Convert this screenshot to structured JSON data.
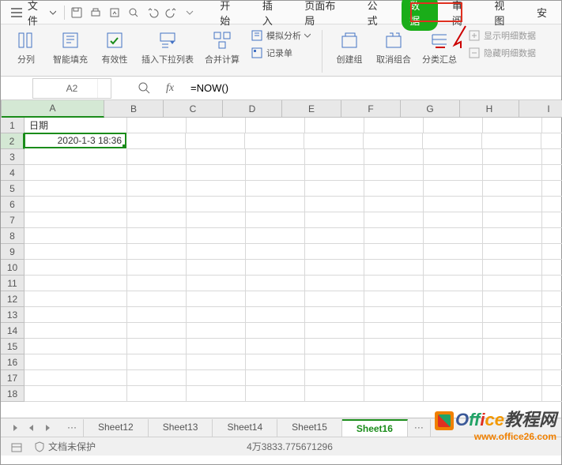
{
  "menubar": {
    "file_label": "文件",
    "tabs": [
      "开始",
      "插入",
      "页面布局",
      "公式",
      "数据",
      "审阅",
      "视图",
      "安"
    ],
    "active_tab_index": 4
  },
  "ribbon": {
    "group1": [
      "分列",
      "智能填充",
      "有效性",
      "插入下拉列表",
      "合并计算"
    ],
    "group1b": [
      "模拟分析",
      "记录单"
    ],
    "group2": [
      "创建组",
      "取消组合",
      "分类汇总"
    ],
    "group3": [
      "显示明细数据",
      "隐藏明细数据"
    ]
  },
  "formula_bar": {
    "name_box": "A2",
    "formula": "=NOW()"
  },
  "grid": {
    "columns": [
      "A",
      "B",
      "C",
      "D",
      "E",
      "F",
      "G",
      "H",
      "I"
    ],
    "rows_count": 18,
    "active_row": 2,
    "active_col": "A",
    "cells": {
      "A1": "日期",
      "A2": "2020-1-3 18:36"
    }
  },
  "sheet_tabs": {
    "tabs": [
      "Sheet12",
      "Sheet13",
      "Sheet14",
      "Sheet15",
      "Sheet16"
    ],
    "active_index": 4,
    "dots": "···"
  },
  "statusbar": {
    "protect": "文档未保护",
    "center": "4万3833.775671296"
  },
  "watermark": {
    "brand": "Office教程网",
    "url": "www.office26.com"
  }
}
